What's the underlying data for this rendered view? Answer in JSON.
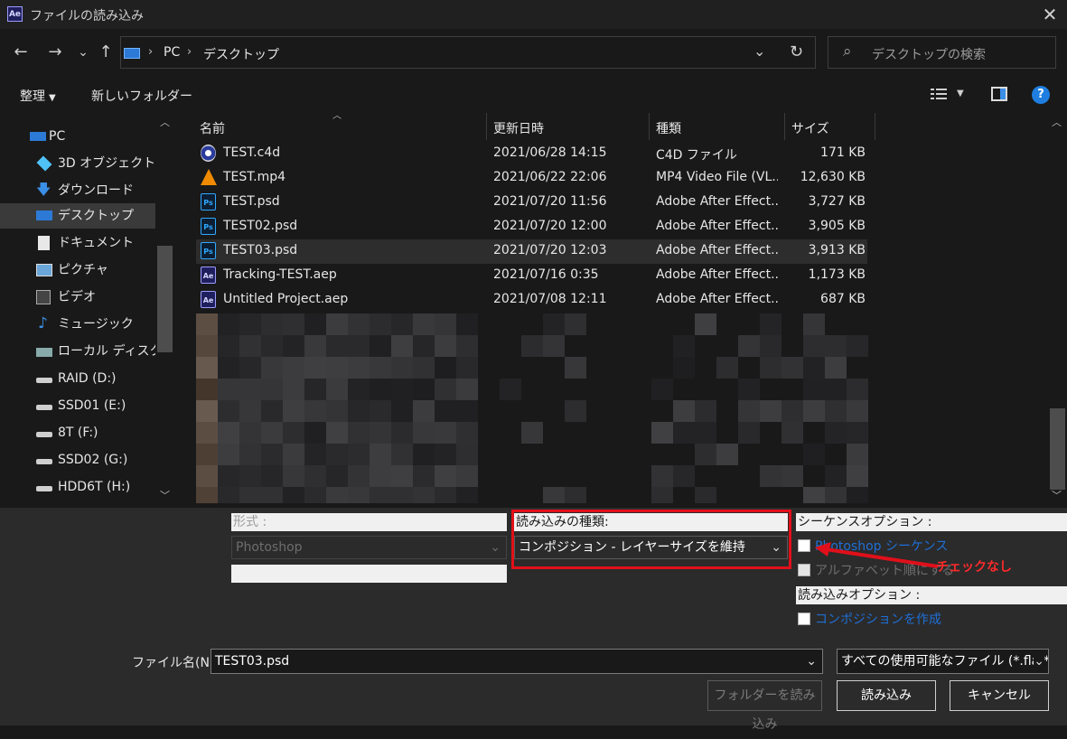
{
  "window": {
    "title": "ファイルの読み込み",
    "app_badge": "Ae",
    "close": "✕"
  },
  "nav": {
    "back": "←",
    "forward": "→",
    "recent": "⌄",
    "up": "↑"
  },
  "address": {
    "crumbs": [
      "PC",
      "デスクトップ"
    ],
    "sep": "›",
    "dropdown": "⌄",
    "refresh": "↻"
  },
  "search": {
    "placeholder": "デスクトップの検索",
    "icon": "⌕"
  },
  "toolbar": {
    "organize": "整理",
    "new_folder": "新しいフォルダー",
    "help": "?"
  },
  "sidebar": {
    "items": [
      {
        "label": "PC",
        "icon": "pc-icon"
      },
      {
        "label": "3D オブジェクト",
        "icon": "cube-icon"
      },
      {
        "label": "ダウンロード",
        "icon": "download-icon"
      },
      {
        "label": "デスクトップ",
        "icon": "desktop-icon",
        "selected": true
      },
      {
        "label": "ドキュメント",
        "icon": "document-icon"
      },
      {
        "label": "ピクチャ",
        "icon": "picture-icon"
      },
      {
        "label": "ビデオ",
        "icon": "video-icon"
      },
      {
        "label": "ミュージック",
        "icon": "music-icon"
      },
      {
        "label": "ローカル ディスク (C:)",
        "icon": "disk-icon"
      },
      {
        "label": "RAID (D:)",
        "icon": "drive-icon"
      },
      {
        "label": "SSD01 (E:)",
        "icon": "drive-icon"
      },
      {
        "label": "8T (F:)",
        "icon": "drive-icon"
      },
      {
        "label": "SSD02 (G:)",
        "icon": "drive-icon"
      },
      {
        "label": "HDD6T (H:)",
        "icon": "drive-icon"
      }
    ]
  },
  "columns": {
    "name": "名前",
    "modified": "更新日時",
    "type": "種類",
    "size": "サイズ"
  },
  "files": [
    {
      "name": "TEST.c4d",
      "modified": "2021/06/28 14:15",
      "type": "C4D ファイル",
      "size": "171 KB",
      "icon": "c4d-icon"
    },
    {
      "name": "TEST.mp4",
      "modified": "2021/06/22 22:06",
      "type": "MP4 Video File (VL...",
      "size": "12,630 KB",
      "icon": "vlc-icon"
    },
    {
      "name": "TEST.psd",
      "modified": "2021/07/20 11:56",
      "type": "Adobe After Effect...",
      "size": "3,727 KB",
      "icon": "psd-icon"
    },
    {
      "name": "TEST02.psd",
      "modified": "2021/07/20 12:00",
      "type": "Adobe After Effect...",
      "size": "3,905 KB",
      "icon": "psd-icon"
    },
    {
      "name": "TEST03.psd",
      "modified": "2021/07/20 12:03",
      "type": "Adobe After Effect...",
      "size": "3,913 KB",
      "icon": "psd-icon",
      "selected": true
    },
    {
      "name": "Tracking-TEST.aep",
      "modified": "2021/07/16 0:35",
      "type": "Adobe After Effect...",
      "size": "1,173 KB",
      "icon": "aep-icon"
    },
    {
      "name": "Untitled Project.aep",
      "modified": "2021/07/08 12:11",
      "type": "Adobe After Effect...",
      "size": "687 KB",
      "icon": "aep-icon"
    }
  ],
  "options": {
    "format_label": "形式 :",
    "format_value": "Photoshop",
    "import_as_label": "読み込みの種類:",
    "import_as_value": "コンポジション - レイヤーサイズを維持",
    "sequence_label": "シーケンスオプション :",
    "photoshop_sequence": "Photoshop シーケンス",
    "alphabetical": "アルファベット順にする",
    "annotation": "チェックなし",
    "import_options_label": "読み込みオプション :",
    "create_composition": "コンポジションを作成"
  },
  "footer": {
    "filename_label": "ファイル名(N):",
    "filename_value": "TEST03.psd",
    "filetype_value": "すべての使用可能なファイル (*.fla;*",
    "import_folder": "フォルダーを読み込み",
    "import": "読み込み",
    "cancel": "キャンセル"
  },
  "colors": {
    "accent": "#1f7ee0",
    "highlight_red": "#e0101a",
    "link_blue": "#1f6fd6"
  }
}
